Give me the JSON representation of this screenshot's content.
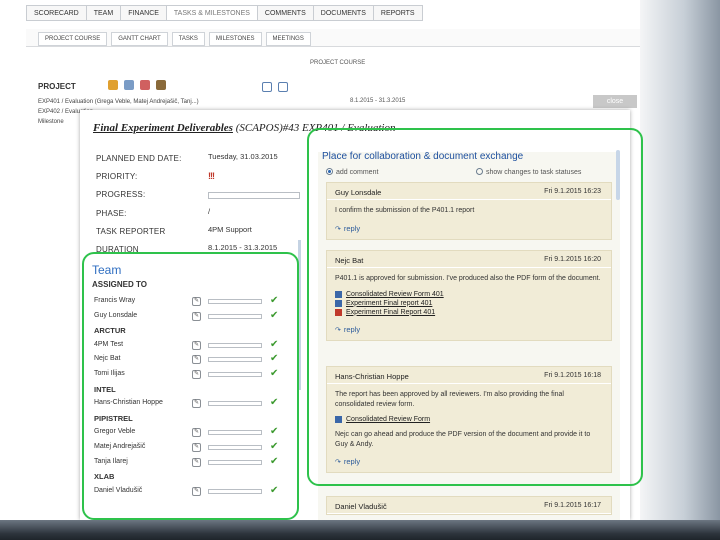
{
  "main_tabs": [
    "SCORECARD",
    "TEAM",
    "FINANCE",
    "TASKS & MILESTONES",
    "COMMENTS",
    "DOCUMENTS",
    "REPORTS"
  ],
  "sub_tabs": [
    "PROJECT COURSE",
    "GANTT CHART",
    "TASKS",
    "MILESTONES",
    "MEETINGS"
  ],
  "background": {
    "caption": "PROJECT COURSE",
    "project_heading": "PROJECT",
    "rows": [
      "EXP401 / Evaluation (Grega Veble, Matej Andrejašič, Tanj...)",
      "EXP402 / Evaluation",
      "Milestone"
    ],
    "date_range": "8.1.2015 - 31.3.2015",
    "close_label": "close"
  },
  "dialog": {
    "title_bold": "Final Experiment Deliverables",
    "title_rest": "(SCAPOS)#43 EXP401 / Evaluation",
    "props": [
      {
        "label": "PLANNED END DATE:",
        "value": "Tuesday, 31.03.2015"
      },
      {
        "label": "PRIORITY:",
        "value": "!!!"
      },
      {
        "label": "PROGRESS:",
        "value": ""
      },
      {
        "label": "PHASE:",
        "value": "/"
      },
      {
        "label": "TASK REPORTER",
        "value": "4PM Support"
      },
      {
        "label": "DURATION",
        "value": "8.1.2015 - 31.3.2015"
      }
    ],
    "team_label": "Team",
    "assigned_title": "ASSIGNED TO",
    "team": [
      {
        "type": "member",
        "name": "Francis Wray"
      },
      {
        "type": "member",
        "name": "Guy Lonsdale"
      },
      {
        "type": "group",
        "name": "ARCTUR"
      },
      {
        "type": "member",
        "name": "4PM Test"
      },
      {
        "type": "member",
        "name": "Nejc Bat"
      },
      {
        "type": "member",
        "name": "Tomi Ilijas"
      },
      {
        "type": "group",
        "name": "INTEL"
      },
      {
        "type": "member",
        "name": "Hans-Christian Hoppe"
      },
      {
        "type": "group",
        "name": "PIPISTREL"
      },
      {
        "type": "member",
        "name": "Gregor Veble"
      },
      {
        "type": "member",
        "name": "Matej Andrejašič"
      },
      {
        "type": "member",
        "name": "Tanja Ilarej"
      },
      {
        "type": "group",
        "name": "XLAB"
      },
      {
        "type": "member",
        "name": "Daniel Vladušič"
      }
    ],
    "collab_label": "Place for collaboration & document exchange",
    "radio_add": "add comment",
    "radio_show": "show changes to task statuses",
    "reply_label": "reply",
    "comments": [
      {
        "author": "Guy Lonsdale",
        "date": "Fri 9.1.2015 16:23",
        "text": "I confirm the submission of the P401.1 report",
        "attachments": []
      },
      {
        "author": "Nejc Bat",
        "date": "Fri 9.1.2015 16:20",
        "text": "P401.1 is approved for submission. I've produced also the PDF form of the document.",
        "attachments": [
          {
            "name": "Consolidated Review Form 401",
            "kind": "doc"
          },
          {
            "name": "Experiment Final report 401",
            "kind": "doc"
          },
          {
            "name": "Experiment Final Report 401",
            "kind": "pdf"
          }
        ]
      },
      {
        "author": "Hans-Christian Hoppe",
        "date": "Fri 9.1.2015 16:18",
        "text": "The report has been approved by all reviewers. I'm also providing the final consolidated review form.",
        "attachments": [
          {
            "name": "Consolidated Review Form",
            "kind": "doc"
          }
        ],
        "text2": "Nejc can go ahead and produce the PDF version of the document and provide it to Guy & Andy."
      },
      {
        "author": "Daniel Vladušič",
        "date": "Fri 9.1.2015 16:17",
        "text": "",
        "attachments": []
      }
    ]
  }
}
